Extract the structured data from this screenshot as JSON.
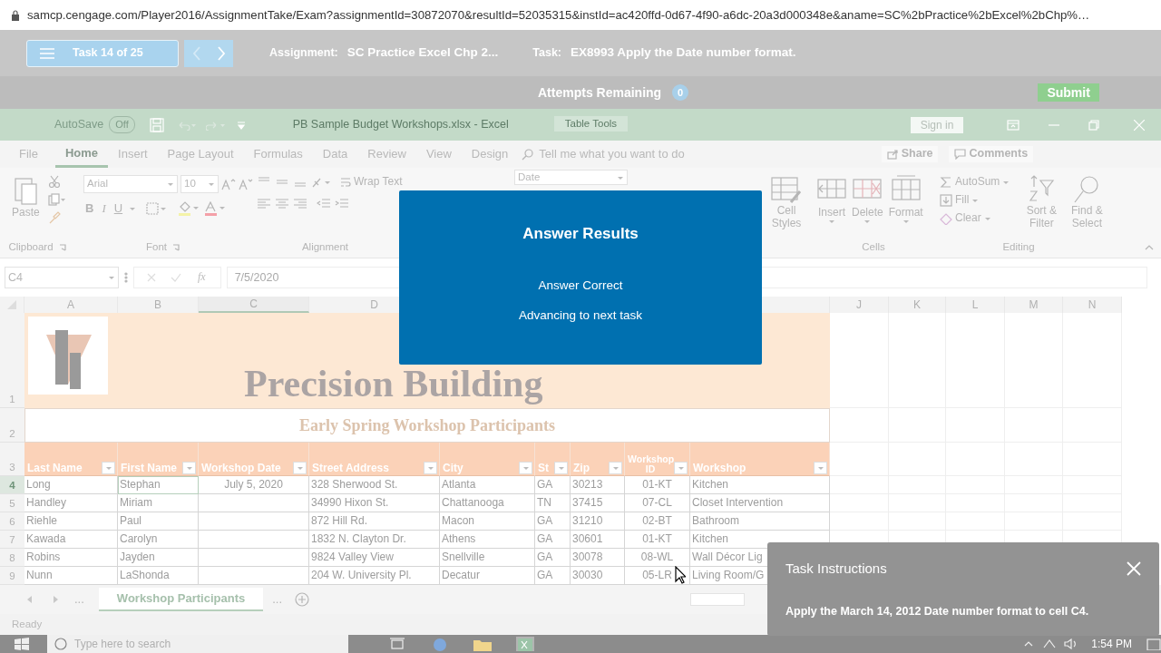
{
  "browser": {
    "url": "samcp.cengage.com/Player2016/AssignmentTake/Exam?assignmentId=30872070&resultId=52035315&instId=ac420ffd-0d67-4f90-a6dc-20a3d000348e&aname=SC%2bPractice%2bExcel%2bChp%…"
  },
  "assignment_bar": {
    "task_counter": "Task 14 of 25",
    "prev": {
      "disabled": true
    },
    "next": {
      "disabled": false
    },
    "assignment_label": "Assignment:",
    "assignment": "SC Practice Excel Chp 2...",
    "task_label": "Task:",
    "task": "EX8993 Apply the Date number format."
  },
  "attempts_bar": {
    "label": "Attempts Remaining",
    "count": "0",
    "submit": "Submit"
  },
  "title_bar": {
    "autosave": "AutoSave",
    "autosave_state": "Off",
    "title": "PB Sample Budget Workshops.xlsx - Excel",
    "context_tab": "Table Tools",
    "sign_in": "Sign in"
  },
  "ribbon_tabs": [
    {
      "label": "File",
      "selected": false
    },
    {
      "label": "Home",
      "selected": true
    },
    {
      "label": "Insert",
      "selected": false
    },
    {
      "label": "Page Layout",
      "selected": false
    },
    {
      "label": "Formulas",
      "selected": false
    },
    {
      "label": "Data",
      "selected": false
    },
    {
      "label": "Review",
      "selected": false
    },
    {
      "label": "View",
      "selected": false
    },
    {
      "label": "Design",
      "selected": false
    }
  ],
  "tell_me": {
    "placeholder": "Tell me what you want to do"
  },
  "share": "Share",
  "comments": "Comments",
  "clipboard": {
    "paste": "Paste",
    "label": "Clipboard"
  },
  "font": {
    "name": "Arial",
    "size": "10",
    "bold": "B",
    "italic": "I",
    "underline": "U",
    "label": "Font"
  },
  "alignment": {
    "wrap_text": "Wrap Text",
    "label": "Alignment"
  },
  "number": {
    "format": "Date"
  },
  "styles": {
    "cell_styles": "Cell Styles"
  },
  "cells": {
    "insert": "Insert",
    "delete": "Delete",
    "format": "Format",
    "label": "Cells"
  },
  "editing": {
    "autosum": "AutoSum",
    "fill": "Fill",
    "clear": "Clear",
    "sort_filter": "Sort & Filter",
    "find_select": "Find & Select",
    "label": "Editing"
  },
  "formula_bar": {
    "name_box": "C4",
    "function_label": "fx",
    "value": "7/5/2020"
  },
  "column_headers_left": [
    {
      "label": "A",
      "selected": false
    },
    {
      "label": "B",
      "selected": false
    },
    {
      "label": "C",
      "selected": true
    },
    {
      "label": "D",
      "selected": false
    }
  ],
  "column_headers_right": [
    {
      "label": "J",
      "selected": false
    },
    {
      "label": "K",
      "selected": false
    },
    {
      "label": "L",
      "selected": false
    },
    {
      "label": "M",
      "selected": false
    },
    {
      "label": "N",
      "selected": false
    }
  ],
  "banner": {
    "number": "1",
    "title": "Precision Building"
  },
  "subtitle": {
    "number": "2",
    "text": "Early Spring Workshop Participants"
  },
  "table": {
    "number": "3",
    "columns": [
      "Last Name",
      "First Name",
      "Workshop Date",
      "Street Address",
      "City",
      "St",
      "Zip",
      "Workshop ID",
      "Workshop"
    ],
    "rows": [
      {
        "number": "4",
        "selected": true,
        "cells": [
          "Long",
          "Stephan",
          "July 5, 2020",
          "328 Sherwood St.",
          "Atlanta",
          "GA",
          "30213",
          "01-KT",
          "Kitchen"
        ]
      },
      {
        "number": "5",
        "selected": false,
        "cells": [
          "Handley",
          "Miriam",
          null,
          "34990 Hixon St.",
          "Chattanooga",
          "TN",
          "37415",
          "07-CL",
          "Closet Intervention"
        ]
      },
      {
        "number": "6",
        "selected": false,
        "cells": [
          "Riehle",
          "Paul",
          null,
          "872 Hill Rd.",
          "Macon",
          "GA",
          "31210",
          "02-BT",
          "Bathroom"
        ]
      },
      {
        "number": "7",
        "selected": false,
        "cells": [
          "Kawada",
          "Carolyn",
          null,
          "1832 N. Clayton Dr.",
          "Athens",
          "GA",
          "30601",
          "01-KT",
          "Kitchen"
        ]
      },
      {
        "number": "8",
        "selected": false,
        "cells": [
          "Robins",
          "Jayden",
          null,
          "9824 Valley View",
          "Snellville",
          "GA",
          "30078",
          "08-WL",
          "Wall Décor Lig"
        ]
      },
      {
        "number": "9",
        "selected": false,
        "cells": [
          "Nunn",
          "LaShonda",
          null,
          "204 W. University Pl.",
          "Decatur",
          "GA",
          "30030",
          "05-LR",
          "Living Room/G"
        ]
      }
    ]
  },
  "sheet_tabs": {
    "more_left": "...",
    "tabs": [
      {
        "label": "Workshop Participants",
        "selected": true
      }
    ],
    "more_right": "..."
  },
  "status_bar": {
    "text": "Ready"
  },
  "modal": {
    "title": "Answer Results",
    "result": "Answer Correct",
    "message": "Advancing to next task"
  },
  "task_instructions": {
    "title": "Task Instructions",
    "text": "Apply the March 14, 2012 Date number format to cell C4."
  },
  "taskbar": {
    "search_placeholder": "Type here to search",
    "time": "1:54 PM"
  }
}
